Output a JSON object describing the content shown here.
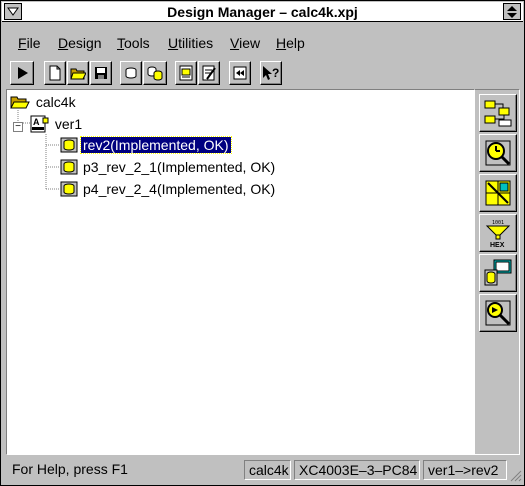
{
  "window": {
    "title": "Design Manager – calc4k.xpj"
  },
  "menubar": {
    "items": [
      {
        "underline": "F",
        "rest": "ile"
      },
      {
        "underline": "D",
        "rest": "esign"
      },
      {
        "underline": "T",
        "rest": "ools"
      },
      {
        "underline": "U",
        "rest": "tilities"
      },
      {
        "underline": "V",
        "rest": "iew"
      },
      {
        "underline": "H",
        "rest": "elp"
      }
    ]
  },
  "toolbar": {
    "buttons": [
      "play-icon",
      "new-file-icon",
      "open-folder-icon",
      "save-icon",
      "chip-icon",
      "chips-copy-icon",
      "report-icon",
      "report-edit-icon",
      "rewind-icon",
      "context-help-icon"
    ]
  },
  "tree": {
    "root": {
      "label": "calc4k",
      "icon": "open-folder-icon"
    },
    "version": {
      "label": "ver1",
      "icon": "version-icon",
      "expander": "−"
    },
    "revisions": [
      {
        "label": "rev2(Implemented, OK)",
        "selected": true
      },
      {
        "label": "p3_rev_2_1(Implemented, OK)",
        "selected": false
      },
      {
        "label": "p4_rev_2_4(Implemented, OK)",
        "selected": false
      }
    ]
  },
  "side_toolbar": {
    "buttons": [
      "flow-engine-icon",
      "timing-analyzer-icon",
      "floorplanner-icon",
      "prom-formatter-icon",
      "hardware-debugger-icon",
      "epic-editor-icon"
    ],
    "hex_label": "HEX"
  },
  "statusbar": {
    "help": "For Help, press F1",
    "project": "calc4k",
    "device": "XC4003E–3–PC84",
    "revision": "ver1–>rev2"
  },
  "colors": {
    "selection": "#000080",
    "chrome": "#c0c0c0",
    "icon_yellow": "#ffff00"
  }
}
